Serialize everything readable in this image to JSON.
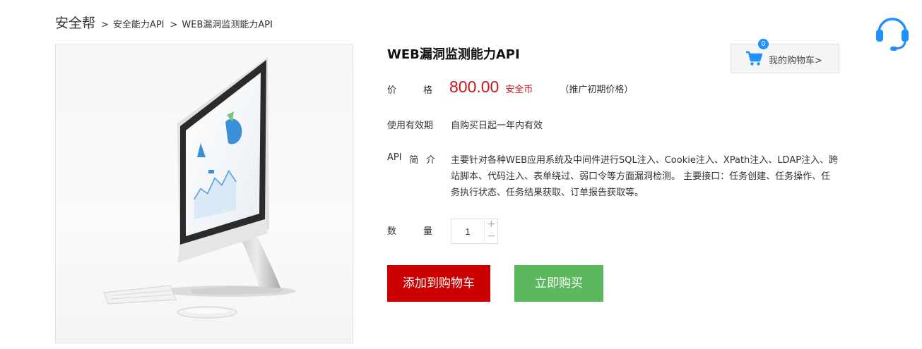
{
  "breadcrumb": {
    "home": "安全帮",
    "sep": ">",
    "items": [
      "安全能力API",
      "WEB漏洞监测能力API"
    ]
  },
  "product": {
    "title": "WEB漏洞监测能力API",
    "price_label_chars": [
      "价",
      "格"
    ],
    "price": "800.00",
    "currency": "安全币",
    "promo_note": "（推广初期价格）",
    "validity_label": "使用有效期",
    "validity_value": "自购买日起一年内有效",
    "api_label_chars": [
      "API",
      "简",
      "介"
    ],
    "api_description": "主要针对各种WEB应用系统及中间件进行SQL注入、Cookie注入、XPath注入、LDAP注入、跨站脚本、代码注入、表单绕过、弱口令等方面漏洞检测。 主要接口：任务创建、任务操作、任务执行状态、任务结果获取、订单报告获取等。",
    "qty_label_chars": [
      "数",
      "量"
    ],
    "quantity": "1",
    "qty_plus": "+",
    "qty_minus": "−"
  },
  "cart": {
    "count": "0",
    "label": "我的购物车>"
  },
  "buttons": {
    "add_to_cart": "添加到购物车",
    "buy_now": "立即购买"
  },
  "icons": {
    "support": "headset-icon",
    "cart": "shopping-cart-icon"
  },
  "colors": {
    "price_red": "#c9151e",
    "add_to_cart_bg": "#cc0000",
    "buy_now_bg": "#5cb85c",
    "accent_blue": "#1e90ff"
  }
}
